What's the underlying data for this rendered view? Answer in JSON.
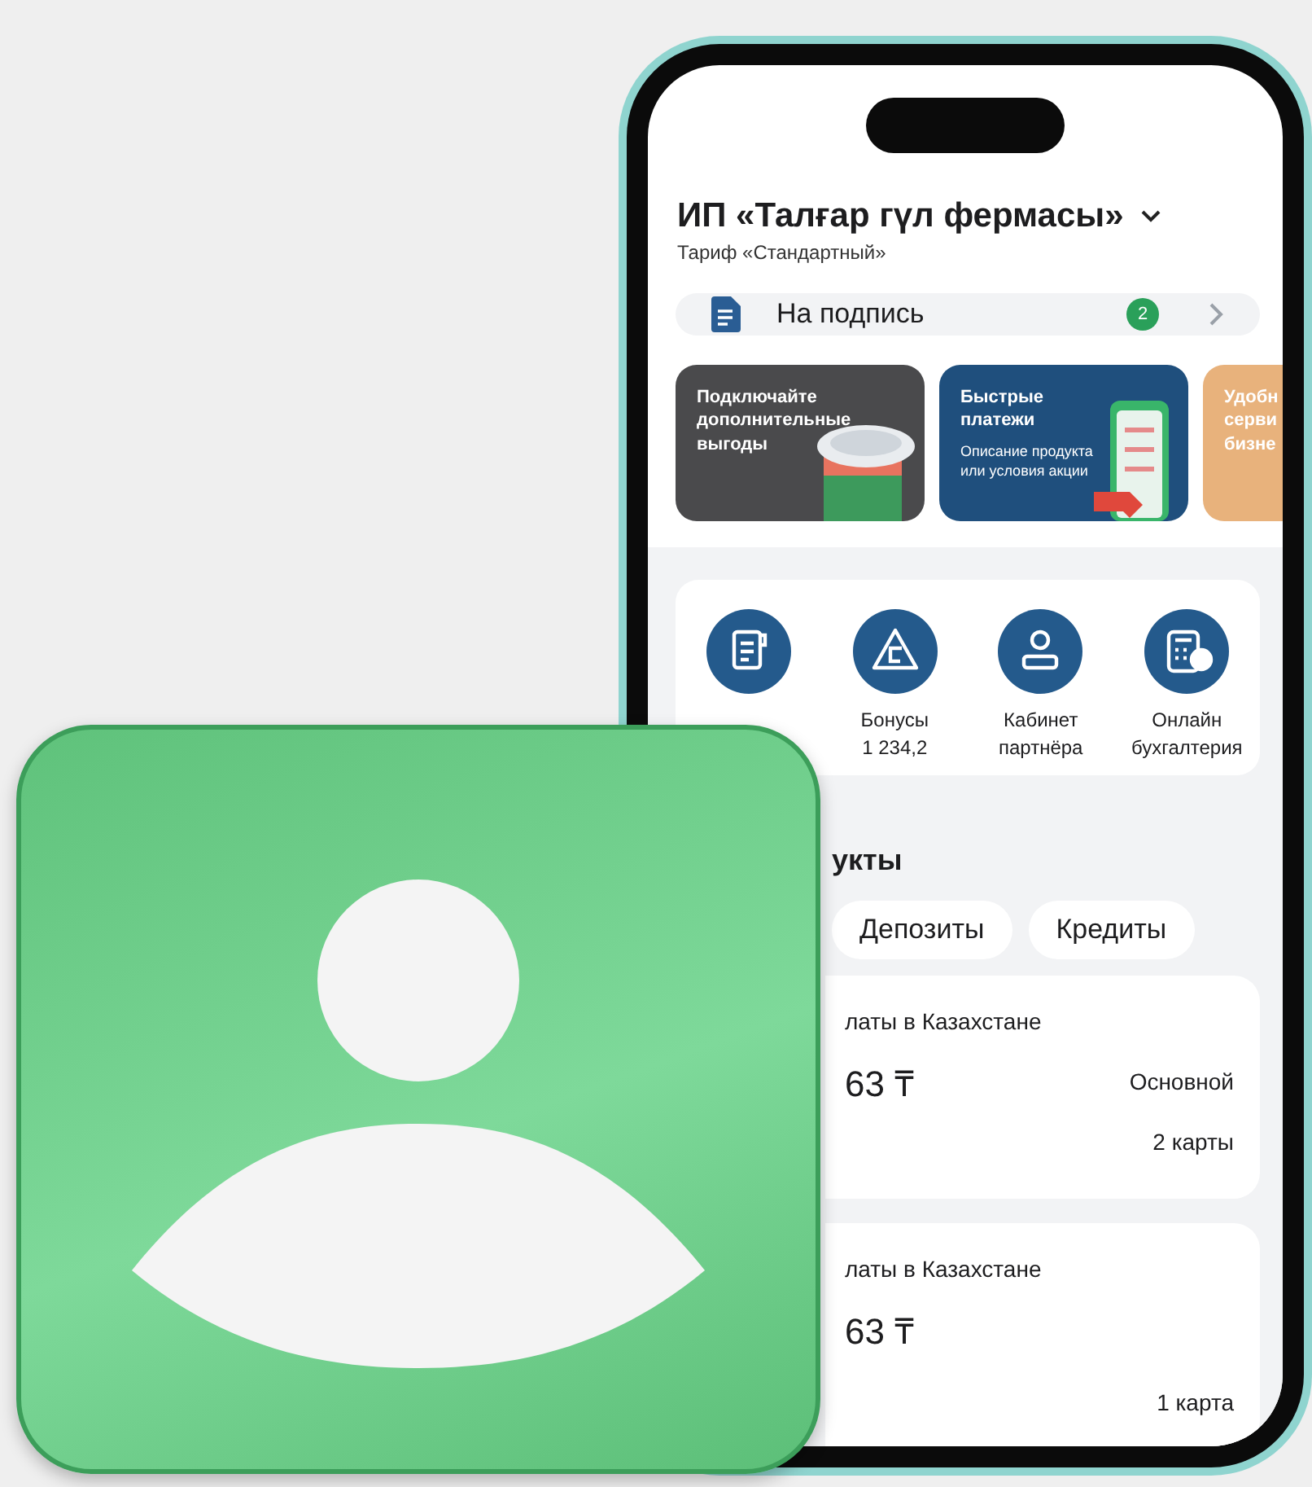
{
  "header": {
    "title": "ИП «Талғар гүл фермасы»",
    "subtitle": "Тариф «Стандартный»"
  },
  "sign_card": {
    "label": "На подпись",
    "badge": "2"
  },
  "promos": [
    {
      "kind": "coins",
      "title": "Подключайте\nдополнительные\nвыгоды"
    },
    {
      "kind": "phone",
      "title": "Быстрые\nплатежи",
      "description": "Описание продукта\nили условия акции"
    },
    {
      "kind": "plain",
      "title": "Удобн\nсерви\nбизне"
    }
  ],
  "services": [
    {
      "kind": "invoice"
    },
    {
      "kind": "bonus",
      "label": "Бонусы\n1 234,2"
    },
    {
      "kind": "partner",
      "label": "Кабинет\nпартнёра"
    },
    {
      "kind": "accounting",
      "label": "Онлайн\nбухгалтерия"
    }
  ],
  "products": {
    "title": "укты",
    "tabs": [
      {
        "label": "Депозиты",
        "selected": false
      },
      {
        "label": "Кредиты",
        "selected": false
      }
    ],
    "accounts": [
      {
        "name": "латы в Казахстане",
        "balance": "63 ₸",
        "tag": "Основной",
        "cards": "2 карты"
      },
      {
        "name": "латы в Казахстане",
        "balance": "63 ₸",
        "cards": "1 карта"
      }
    ]
  }
}
